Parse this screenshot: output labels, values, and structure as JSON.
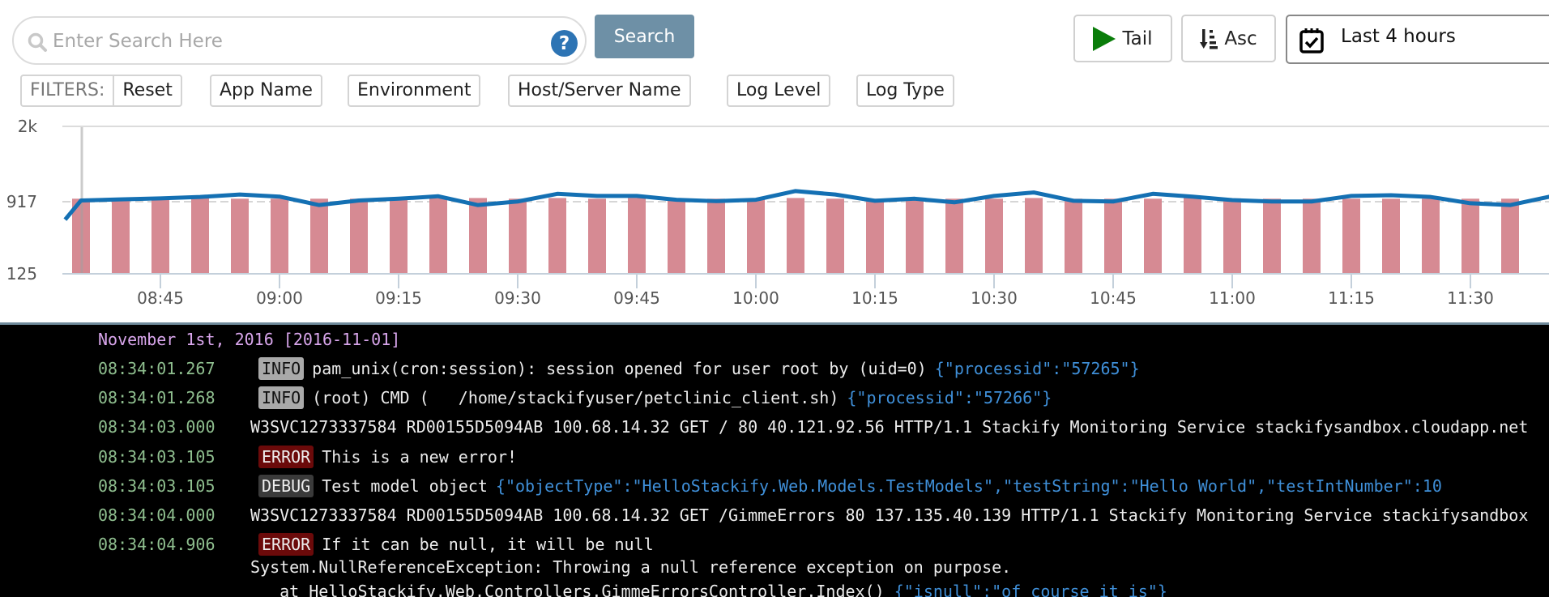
{
  "search": {
    "placeholder": "Enter Search Here",
    "value": "",
    "help_icon": "question-circle-icon",
    "button_label": "Search"
  },
  "toolbar": {
    "tail_label": "Tail",
    "tail_icon": "play-icon",
    "sort_label": "Asc",
    "sort_icon": "sort-ascending-icon",
    "date_range_label": "Last 4 hours",
    "date_range_icon": "calendar-check-icon"
  },
  "filters": {
    "label": "FILTERS:",
    "reset_label": "Reset",
    "items": [
      {
        "label": "App Name"
      },
      {
        "label": "Environment"
      },
      {
        "label": "Host/Server Name"
      },
      {
        "label": "Log Level"
      },
      {
        "label": "Log Type"
      }
    ]
  },
  "colors": {
    "bar": "#d68a93",
    "line": "#1470b3",
    "search_button": "#6e90a6",
    "tail_icon": "#0a7d0a",
    "help_icon": "#2d74b4",
    "timestamp": "#8fbf8f",
    "date_header": "#d9a6ec",
    "json": "#3f8fd8",
    "badge_info": "#a9a9a9",
    "badge_error": "#6b0a0a",
    "badge_debug": "#3a3a3a"
  },
  "chart_data": {
    "type": "bar",
    "title": "",
    "xlabel": "",
    "ylabel": "",
    "y_tick_labels": [
      "2k",
      "917",
      "125"
    ],
    "y_ticks": [
      2000,
      917,
      125
    ],
    "ylim": [
      125,
      2000
    ],
    "grid": "horizontal",
    "x_tick_labels": [
      "08:45",
      "09:00",
      "09:15",
      "09:30",
      "09:45",
      "10:00",
      "10:15",
      "10:30",
      "10:45",
      "11:00",
      "11:15",
      "11:30"
    ],
    "marker_time": "08:35",
    "categories": [
      "08:35",
      "08:40",
      "08:45",
      "08:50",
      "08:55",
      "09:00",
      "09:05",
      "09:10",
      "09:15",
      "09:20",
      "09:25",
      "09:30",
      "09:35",
      "09:40",
      "09:45",
      "09:50",
      "09:55",
      "10:00",
      "10:05",
      "10:10",
      "10:15",
      "10:20",
      "10:25",
      "10:30",
      "10:35",
      "10:40",
      "10:45",
      "10:50",
      "10:55",
      "11:00",
      "11:05",
      "11:10",
      "11:15",
      "11:20",
      "11:25",
      "11:30",
      "11:35"
    ],
    "series": [
      {
        "name": "bars",
        "type": "bar",
        "values": [
          960,
          970,
          965,
          965,
          960,
          960,
          960,
          960,
          960,
          965,
          970,
          960,
          970,
          960,
          970,
          960,
          960,
          960,
          970,
          960,
          960,
          960,
          960,
          960,
          970,
          960,
          960,
          960,
          970,
          965,
          960,
          960,
          960,
          960,
          960,
          960,
          960
        ]
      },
      {
        "name": "line",
        "type": "line",
        "x_start": "08:33",
        "values": [
          720,
          935,
          950,
          965,
          985,
          1020,
          990,
          880,
          935,
          960,
          995,
          880,
          920,
          1030,
          1000,
          1000,
          945,
          925,
          945,
          1070,
          1020,
          930,
          960,
          910,
          1000,
          1050,
          930,
          920,
          1030,
          990,
          940,
          920,
          920,
          1000,
          1010,
          985,
          900,
          880,
          990
        ]
      }
    ]
  },
  "logs": {
    "date_header": "November 1st, 2016 [2016-11-01]",
    "rows": [
      {
        "time": "08:34:01.267",
        "level": "INFO",
        "message": "pam_unix(cron:session): session opened for user root by (uid=0)",
        "json": "{\"processid\":\"57265\"}"
      },
      {
        "time": "08:34:01.268",
        "level": "INFO",
        "message": "(root) CMD (   /home/stackifyuser/petclinic_client.sh)",
        "json": "{\"processid\":\"57266\"}"
      },
      {
        "time": "08:34:03.000",
        "level": "",
        "message": "W3SVC1273337584 RD00155D5094AB 100.68.14.32 GET / 80 40.121.92.56 HTTP/1.1 Stackify Monitoring Service stackifysandbox.cloudapp.net",
        "json": ""
      },
      {
        "time": "08:34:03.105",
        "level": "ERROR",
        "message": "This is a new error!",
        "json": ""
      },
      {
        "time": "08:34:03.105",
        "level": "DEBUG",
        "message": "Test model object",
        "json": "{\"objectType\":\"HelloStackify.Web.Models.TestModels\",\"testString\":\"Hello World\",\"testIntNumber\":10"
      },
      {
        "time": "08:34:04.000",
        "level": "",
        "message": "W3SVC1273337584 RD00155D5094AB 100.68.14.32 GET /GimmeErrors 80 137.135.40.139 HTTP/1.1 Stackify Monitoring Service stackifysandbox",
        "json": ""
      },
      {
        "time": "08:34:04.906",
        "level": "ERROR",
        "message": "If it can be null, it will be null",
        "json": ""
      }
    ],
    "stack_trace": [
      {
        "text": "System.NullReferenceException: Throwing a null reference exception on purpose.",
        "json": ""
      },
      {
        "text": "   at HelloStackify.Web.Controllers.GimmeErrorsController.Index()",
        "json": "{\"isnull\":\"of course it is\"}"
      }
    ]
  }
}
